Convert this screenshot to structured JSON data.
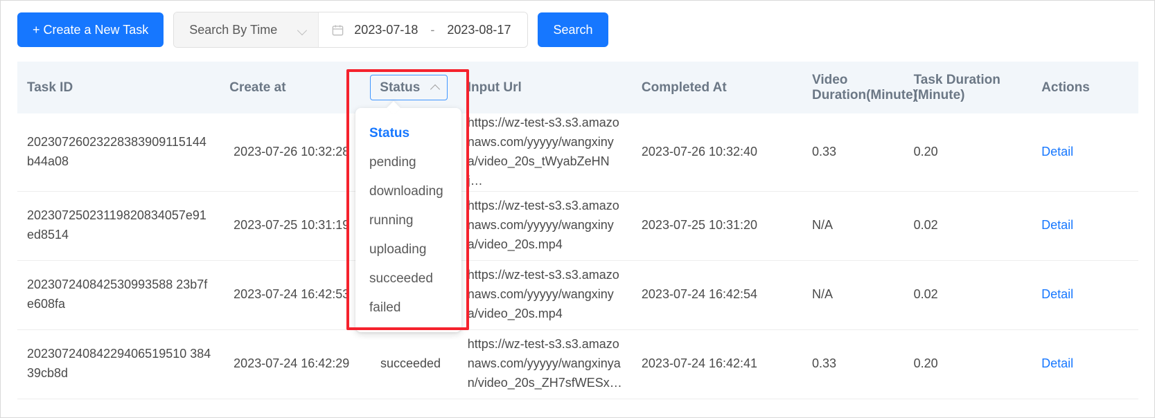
{
  "toolbar": {
    "create_task_label": "+ Create a New Task",
    "search_by": {
      "selected": "Search By Time",
      "chevron_icon": "chevron-down-icon"
    },
    "date_range": {
      "calendar_icon": "calendar-icon",
      "start": "2023-07-18",
      "separator": "-",
      "end": "2023-08-17"
    },
    "search_label": "Search"
  },
  "table": {
    "columns": [
      {
        "key": "task_id",
        "label": "Task ID"
      },
      {
        "key": "create_at",
        "label": "Create at"
      },
      {
        "key": "status",
        "label": "Status"
      },
      {
        "key": "input_url",
        "label": "Input Url"
      },
      {
        "key": "completed_at",
        "label": "Completed At"
      },
      {
        "key": "video_duration",
        "label": "Video Duration(Minute)"
      },
      {
        "key": "task_duration",
        "label": "Task Duration (Minute)"
      },
      {
        "key": "actions",
        "label": "Actions"
      }
    ],
    "rows": [
      {
        "task_id": "20230726023228383909115144b44a08",
        "create_at": "2023-07-26 10:32:28",
        "status": "",
        "input_url": "https://wz-test-s3.s3.amazonaws.com/yyyyy/wangxinya/video_20s_tWyabZeHNj…",
        "completed_at": "2023-07-26 10:32:40",
        "video_duration": "0.33",
        "task_duration": "0.20",
        "action_label": "Detail"
      },
      {
        "task_id": "20230725023119820834057e91ed8514",
        "create_at": "2023-07-25 10:31:19",
        "status": "",
        "input_url": "https://wz-test-s3.s3.amazonaws.com/yyyyy/wangxinya/video_20s.mp4",
        "completed_at": "2023-07-25 10:31:20",
        "video_duration": "N/A",
        "task_duration": "0.02",
        "action_label": "Detail"
      },
      {
        "task_id": "202307240842530993588 23b7fe608fa",
        "create_at": "2023-07-24 16:42:53",
        "status": "",
        "input_url": "https://wz-test-s3.s3.amazonaws.com/yyyyy/wangxinya/video_20s.mp4",
        "completed_at": "2023-07-24 16:42:54",
        "video_duration": "N/A",
        "task_duration": "0.02",
        "action_label": "Detail"
      },
      {
        "task_id": "20230724084229406519510 38439cb8d",
        "create_at": "2023-07-24 16:42:29",
        "status": "succeeded",
        "input_url": "https://wz-test-s3.s3.amazonaws.com/yyyyy/wangxinyan/video_20s_ZH7sfWESx…",
        "completed_at": "2023-07-24 16:42:41",
        "video_duration": "0.33",
        "task_duration": "0.20",
        "action_label": "Detail"
      }
    ]
  },
  "status_filter": {
    "button_label": "Status",
    "chevron_icon": "chevron-up-icon",
    "open": true,
    "options": [
      {
        "label": "Status",
        "selected": true
      },
      {
        "label": "pending",
        "selected": false
      },
      {
        "label": "downloading",
        "selected": false
      },
      {
        "label": "running",
        "selected": false
      },
      {
        "label": "uploading",
        "selected": false
      },
      {
        "label": "succeeded",
        "selected": false
      },
      {
        "label": "failed",
        "selected": false
      }
    ]
  },
  "annotation": {
    "shape": "rectangle-highlight",
    "color": "#f5222d"
  },
  "colors": {
    "primary": "#1677ff",
    "header_bg": "#f2f6fa",
    "link": "#1677ff",
    "annotation": "#f5222d"
  }
}
